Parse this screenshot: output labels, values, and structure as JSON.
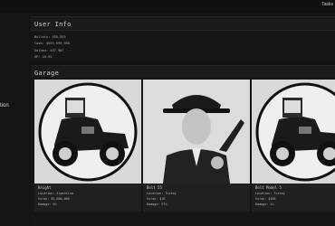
{
  "topbar": {
    "link_label": "Tasks"
  },
  "sidebar": {
    "item_label": "tion"
  },
  "user_info": {
    "title": "User Info",
    "stats": [
      "Bullets: 555,555",
      "Cash: $555,999,995",
      "Golden: 437,987",
      "XP: 10.9%"
    ]
  },
  "garage": {
    "title": "Garage",
    "cars": [
      {
        "name": "Knight",
        "location": "Location: Argentina",
        "value": "Value: $5,000,000",
        "damage": "Damage: 0%",
        "image": "vintage-car"
      },
      {
        "name": "Bolt 55",
        "location": "Location: Turkey",
        "value": "Value: $18",
        "damage": "Damage: 97%",
        "image": "gangster-with-gun"
      },
      {
        "name": "Bolt Model 5",
        "location": "Location: Turkey",
        "value": "Value: $500",
        "damage": "Damage: 2%",
        "image": "vintage-car"
      }
    ]
  }
}
